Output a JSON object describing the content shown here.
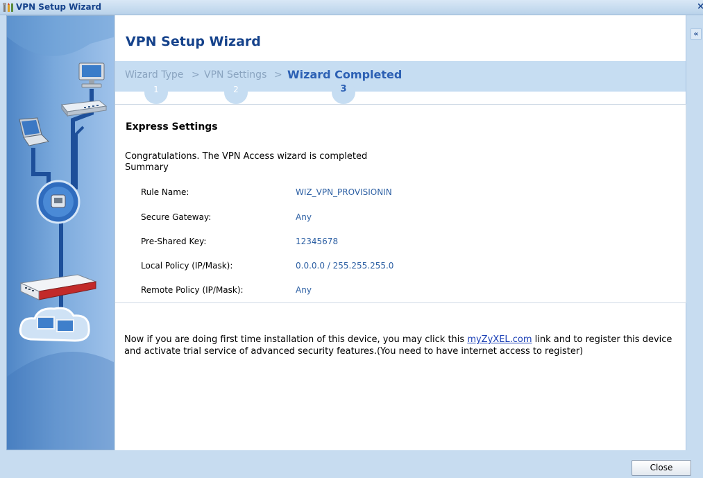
{
  "window": {
    "title": "VPN Setup Wizard",
    "close_glyph": "×",
    "collapse_glyph": "«"
  },
  "wizard": {
    "heading": "VPN Setup Wizard",
    "steps": [
      {
        "label": "Wizard Type",
        "number": "1",
        "active": false
      },
      {
        "label": "VPN Settings",
        "number": "2",
        "active": false
      },
      {
        "label": "Wizard Completed",
        "number": "3",
        "active": true
      }
    ],
    "separator": ">"
  },
  "express": {
    "heading": "Express Settings",
    "congrats": "Congratulations. The VPN Access wizard is completed",
    "summary": "Summary",
    "rows": [
      {
        "label": "Rule Name:",
        "value": "WIZ_VPN_PROVISIONIN"
      },
      {
        "label": "Secure Gateway:",
        "value": "Any"
      },
      {
        "label": "Pre-Shared Key:",
        "value": "12345678"
      },
      {
        "label": "Local Policy (IP/Mask):",
        "value": "0.0.0.0 / 255.255.255.0"
      },
      {
        "label": "Remote Policy (IP/Mask):",
        "value": "Any"
      }
    ]
  },
  "note": {
    "before": "Now if you are doing first time installation of this device, you may click this ",
    "link": "myZyXEL.com",
    "after": " link and to register this device and activate trial service of advanced security features.(You need to have internet access to register)"
  },
  "footer": {
    "close_label": "Close"
  },
  "colors": {
    "accent": "#15428b",
    "active_step": "#2c60b4",
    "value_text": "#2c5fa3",
    "link": "#1a3fb5"
  }
}
